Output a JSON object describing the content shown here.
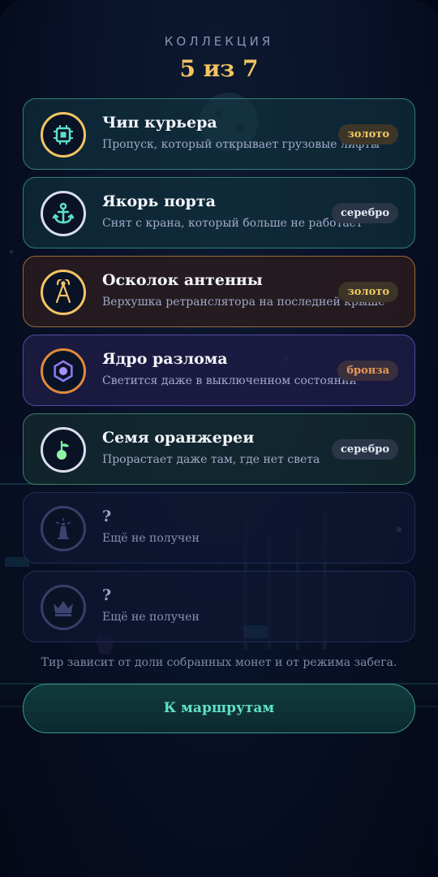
{
  "header": {
    "title": "КОЛЛЕКЦИЯ",
    "count": "5 из 7"
  },
  "items": [
    {
      "title": "Чип курьера",
      "description": "Пропуск, который открывает грузовые лифты",
      "tier": "золото",
      "icon": "chip-icon",
      "ring_color": "#f2c464"
    },
    {
      "title": "Якорь порта",
      "description": "Снят с крана, который больше не работает",
      "tier": "серебро",
      "icon": "anchor-icon",
      "ring_color": "#d8deee"
    },
    {
      "title": "Осколок антенны",
      "description": "Верхушка ретранслятора на последней крыше",
      "tier": "золото",
      "icon": "antenna-icon",
      "ring_color": "#f2c464"
    },
    {
      "title": "Ядро разлома",
      "description": "Светится даже в выключенном состоянии",
      "tier": "бронза",
      "icon": "core-hexagon-icon",
      "ring_color": "#e08a3c"
    },
    {
      "title": "Семя оранжереи",
      "description": "Прорастает даже там, где нет света",
      "tier": "серебро",
      "icon": "seed-sprout-icon",
      "ring_color": "#d8deee"
    },
    {
      "title": "?",
      "description": "Ещё не получен",
      "icon": "lighthouse-icon",
      "locked": true
    },
    {
      "title": "?",
      "description": "Ещё не получен",
      "icon": "crown-icon",
      "locked": true
    }
  ],
  "footer": {
    "note": "Тир зависит от доли собранных монет и от режима забега.",
    "button_label": "К маршрутам"
  },
  "colors": {
    "gold": "#f2c464",
    "silver": "#e3e8f2",
    "bronze": "#e69a58",
    "accent_teal": "#5fe0c6",
    "background": "#070d22"
  }
}
